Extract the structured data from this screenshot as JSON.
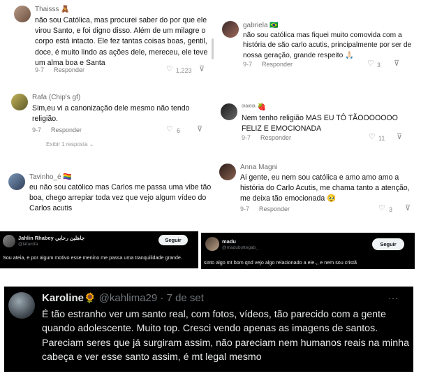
{
  "comments": [
    {
      "username": "Thaisss",
      "badge": "🧸",
      "text": "não sou Católica, mas procurei saber do por que ele virou Santo, e foi digno disso. Além de um milagre o corpo está intacto. Ele fez tantas coisas boas, gentil, doce, é muito lindo as ações dele, mereceu, ele teve um alma boa e Santa",
      "date": "9-7",
      "reply_label": "Responder",
      "likes": "1.223"
    },
    {
      "username": "gabriela",
      "badge": "🇧🇷",
      "text": "não sou católica mas fiquei muito comovida com a história de são carlo acutis, principalmente por ser de nossa geração, grande respeito 🙏🏻",
      "date": "9-7",
      "reply_label": "Responder",
      "likes": "3"
    },
    {
      "username": "Rafa (Chip's gf)",
      "badge": "",
      "text": "Sim,eu vi a canonização dele mesmo não tendo religião.",
      "date": "9-7",
      "reply_label": "Responder",
      "likes": "6",
      "view_replies": "Exibir 1 resposta ⌄"
    },
    {
      "username": "ᵒᶦᵃᶦᵒᶦᵃ",
      "badge": "🍓",
      "text": "Nem tenho religião MAS EU TÔ TÃOOOOOOO FELIZ E EMOCIONADA",
      "date": "9-7",
      "reply_label": "Responder",
      "likes": "11"
    },
    {
      "username": "Tavinho_é",
      "badge": "🏳️‍🌈",
      "text": "eu não sou católico mas Carlos me passa uma vibe tão boa, chego arrepiar toda vez que vejo algum vídeo do Carlos acutis",
      "date": "",
      "reply_label": "",
      "likes": ""
    },
    {
      "username": "Anna Magni",
      "badge": "",
      "text": "Ai gente, eu nem sou católica e amo amo amo a história do Carlo Acutis, me chama tanto a atenção, me deixa tão emocionada 🥹",
      "date": "9-7",
      "reply_label": "Responder",
      "likes": "3"
    }
  ],
  "tweets": [
    {
      "name": "Jahlin Rhabey جاهلين رحابي",
      "handle": "@lafarofa",
      "follow_label": "Seguir",
      "text": "Sou ateia, e por algum motivo esse menino me passa uma tranquilidade grande."
    },
    {
      "name": "madu",
      "handle": "@madubottegab_",
      "follow_label": "Seguir",
      "text": "sinto algo mt bom qnd vejo algo relacionado a ele.,, e nem sou cristã"
    }
  ],
  "main_tweet": {
    "name": "Karoline",
    "emoji": "🌻",
    "handle": "@kahlima29",
    "date": "· 7 de set",
    "more": "···",
    "text": "É tão estranho ver um santo real, com fotos, vídeos, tão parecido com a gente quando adolescente. Muito top. Cresci vendo apenas as imagens de santos. Pareciam seres que já surgiram assim, não pareciam nem humanos reais na minha cabeça e ver esse santo assim, é mt legal mesmo"
  },
  "icons": {
    "like": "heart-outline-icon",
    "dislike": "thumbs-down-icon",
    "more": "more-icon"
  }
}
